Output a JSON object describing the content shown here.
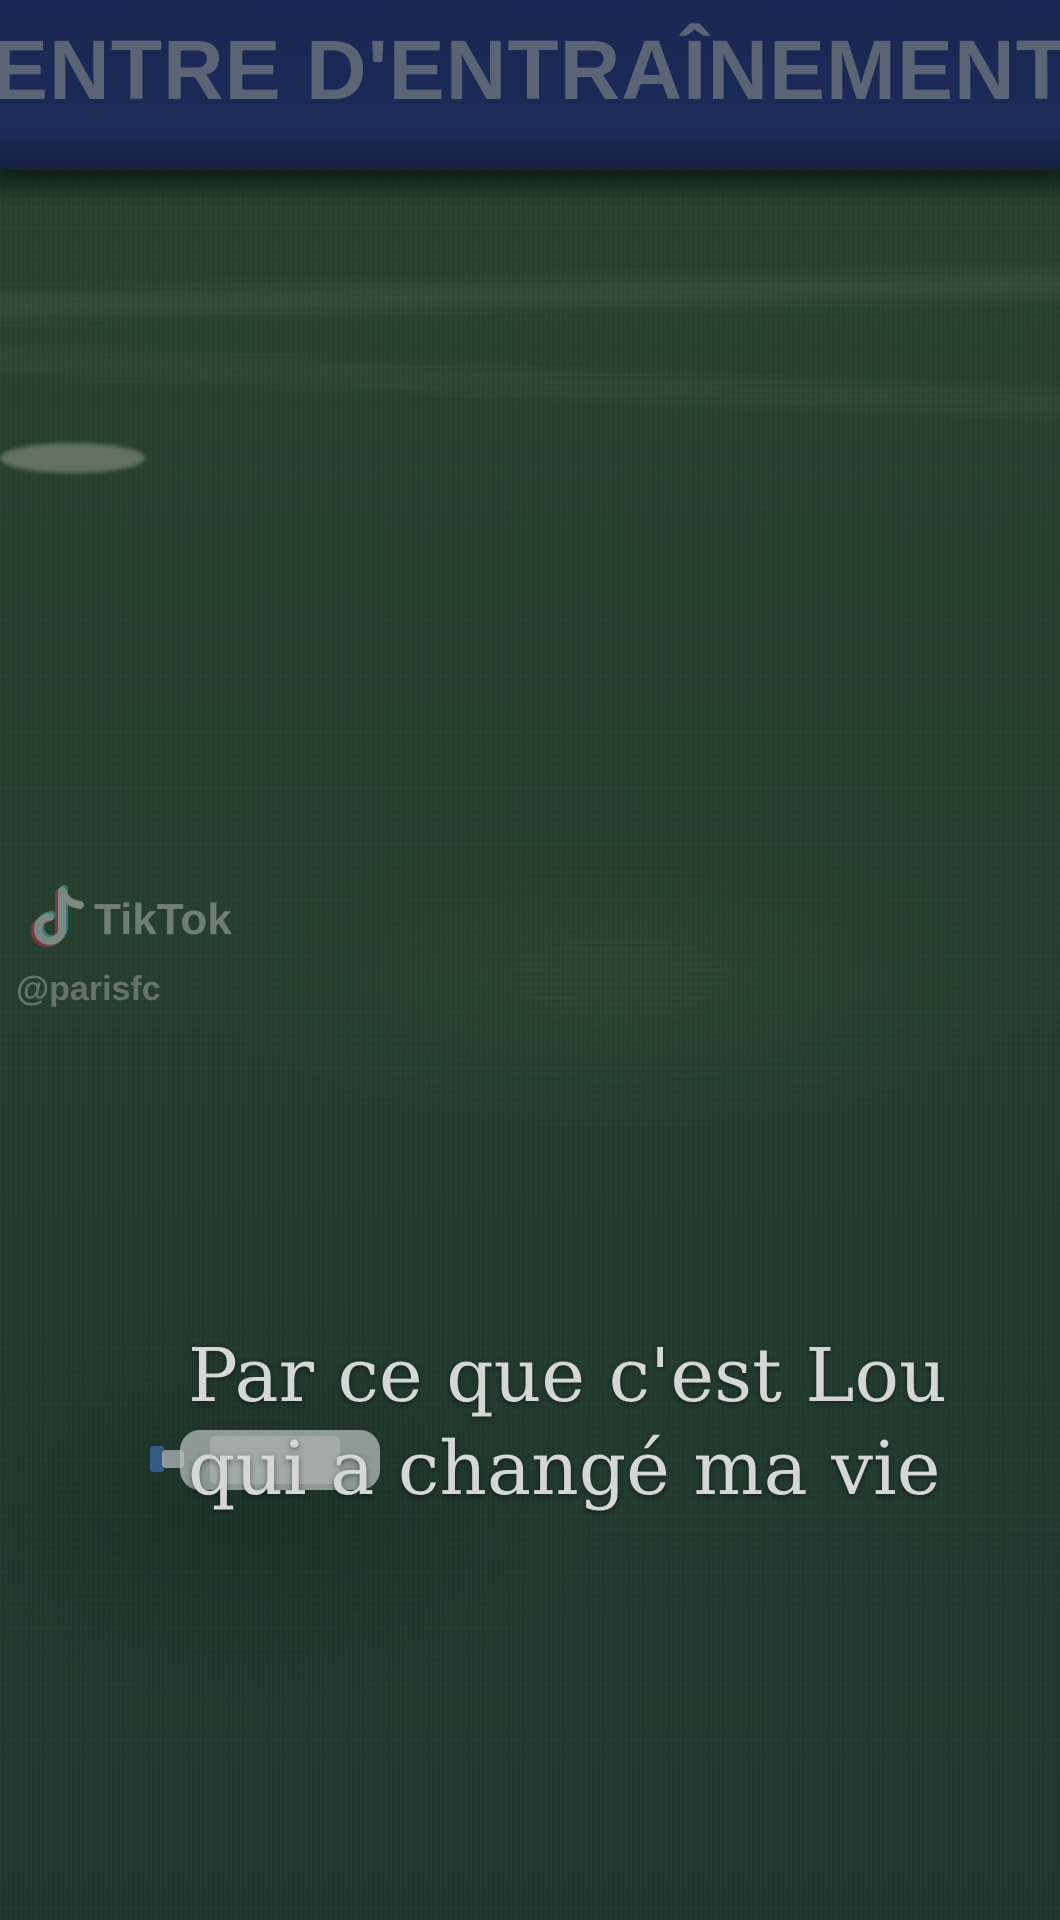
{
  "banner": {
    "text": "ENTRE D'ENTRAÎNEMENT"
  },
  "watermark": {
    "brand": "TikTok",
    "handle": "@parisfc",
    "icon": "tiktok-logo-icon"
  },
  "caption": {
    "line1": "Par ce que c'est Lou",
    "line2": "qui a changé ma vie"
  },
  "colors": {
    "banner": "#1d2f66",
    "grass": "#2a4732",
    "caption": "#ffffff"
  }
}
